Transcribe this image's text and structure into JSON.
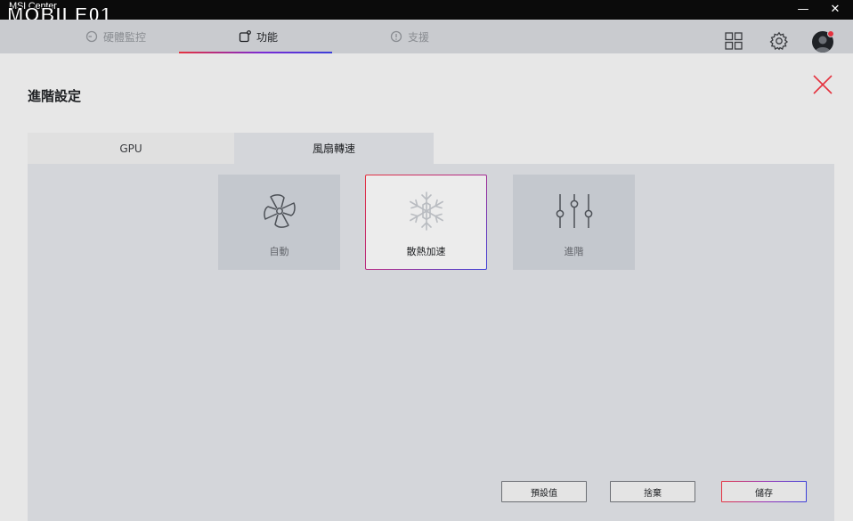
{
  "window": {
    "title": "MSI Center",
    "watermark": "MOBILE01",
    "minimize_glyph": "—",
    "close_glyph": "✕"
  },
  "nav": {
    "tabs": [
      {
        "label": "硬體監控",
        "icon": "gauge-icon",
        "active": false
      },
      {
        "label": "功能",
        "icon": "feature-icon",
        "active": true
      },
      {
        "label": "支援",
        "icon": "support-icon",
        "active": false
      }
    ],
    "right_icons": [
      "grid-icon",
      "gear-icon",
      "avatar"
    ]
  },
  "page": {
    "title": "進階設定",
    "close_icon": "close-icon"
  },
  "subtabs": [
    {
      "label": "GPU",
      "active": false
    },
    {
      "label": "風扇轉速",
      "active": true
    }
  ],
  "modes": [
    {
      "label": "自動",
      "icon": "fan-icon",
      "selected": false
    },
    {
      "label": "散熱加速",
      "icon": "snowflake-icon",
      "selected": true
    },
    {
      "label": "進階",
      "icon": "sliders-icon",
      "selected": false
    }
  ],
  "actions": {
    "default_label": "預設值",
    "discard_label": "捨棄",
    "save_label": "儲存"
  },
  "colors": {
    "accent_red": "#e5323f",
    "accent_blue": "#3b3fd8",
    "nav_bg": "#c9cbcf",
    "panel_bg": "#e7e7e7",
    "content_bg": "#d4d6da"
  }
}
